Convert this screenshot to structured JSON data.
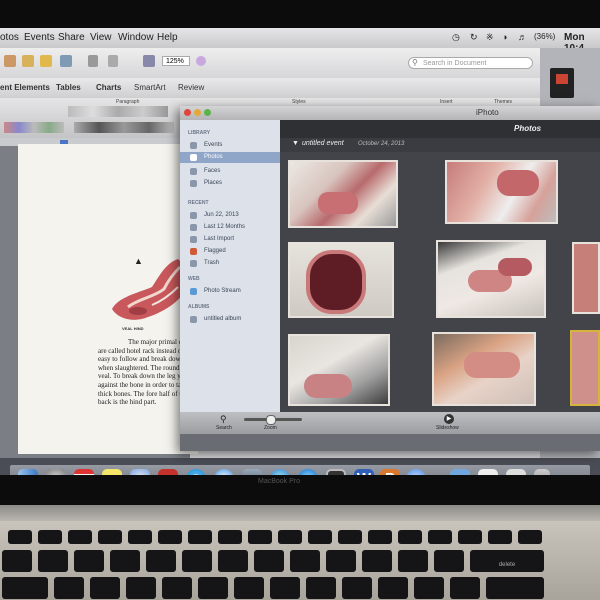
{
  "menubar": {
    "items": [
      "otos",
      "Events",
      "Share",
      "View",
      "Window",
      "Help"
    ],
    "battery": "(36%)",
    "clock": "Mon 10:4"
  },
  "word": {
    "ribbon_tabs": [
      "ent Elements",
      "Tables",
      "Charts",
      "SmartArt",
      "Review"
    ],
    "ribbon_groups": [
      "Paragraph",
      "Styles",
      "Insert",
      "Themes"
    ],
    "search_placeholder": "Search in Document",
    "zoom": "125%",
    "figure_label": "VEAL HIND",
    "text_lines": [
      "The major primal cut",
      "are called hotel rack instead of",
      "easy to follow and break down",
      "when slaughtered. The round",
      "veal. To break down the leg yo",
      "against the bone in order to ta",
      "thick bones. The fore half of th",
      "back is the hind part."
    ]
  },
  "iphoto": {
    "title": "iPhoto",
    "section_title": "Photos",
    "event_name": "untitled event",
    "event_date": "October 24, 2013",
    "library_header": "LIBRARY",
    "library_items": [
      "Events",
      "Photos",
      "Faces",
      "Places"
    ],
    "recent_header": "RECENT",
    "recent_items": [
      "Jun 22, 2013",
      "Last 12 Months",
      "Last Import",
      "Flagged",
      "Trash"
    ],
    "web_header": "WEB",
    "web_items": [
      "Photo Stream"
    ],
    "albums_header": "ALBUMS",
    "album_items": [
      "untitled album"
    ],
    "bottom": {
      "search": "Search",
      "zoom": "Zoom",
      "slideshow": "Slideshow"
    }
  },
  "dock": {
    "apps": [
      "Finder",
      "Launchpad",
      "Calendar",
      "Stickies",
      "Mail",
      "Word",
      "Skype",
      "Safari",
      "iPhoto",
      "iTunes",
      "App Store",
      "Photo Booth",
      "Word",
      "PowerPoint",
      "Messages",
      "Folder",
      "Preview",
      "Notes",
      "Trash"
    ]
  },
  "laptop": {
    "brand": "MacBook Pro"
  },
  "keyboard": {
    "delete_label": "delete"
  },
  "colors": {
    "sidebar_selected": "#8fa6c9",
    "meat": "#c45a5e",
    "iphoto_bg": "#424449"
  }
}
